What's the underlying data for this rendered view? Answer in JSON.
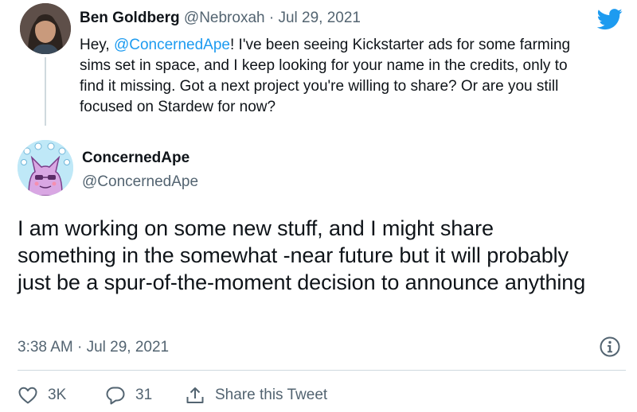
{
  "parent_tweet": {
    "display_name": "Ben Goldberg",
    "handle": "@Nebroxah",
    "separator": "·",
    "date": "Jul 29, 2021",
    "mention": "@ConcernedApe",
    "text_before_mention": "Hey, ",
    "text_after_mention": "!  I've been seeing Kickstarter ads for some farming sims set in space, and I keep looking for your name in the credits, only to find it missing.  Got a next project you're willing to share?  Or are you still focused on Stardew for now?"
  },
  "main_tweet": {
    "display_name": "ConcernedApe",
    "handle": "@ConcernedApe",
    "text": "I am working on some new stuff, and I might share something in the somewhat -near future but  it will probably just be a spur-of-the-moment decision to announce anything",
    "timestamp": "3:38 AM · Jul 29, 2021"
  },
  "actions": {
    "likes": "3K",
    "replies": "31",
    "share_label": "Share this Tweet"
  },
  "icons": {
    "brand": "twitter-bird-icon",
    "info": "info-icon",
    "like": "heart-icon",
    "reply": "speech-bubble-icon",
    "share": "share-icon"
  },
  "colors": {
    "twitter_blue": "#1d9bf0",
    "muted_text": "#536471",
    "text": "#0f1419",
    "divider": "#cfd9de"
  }
}
